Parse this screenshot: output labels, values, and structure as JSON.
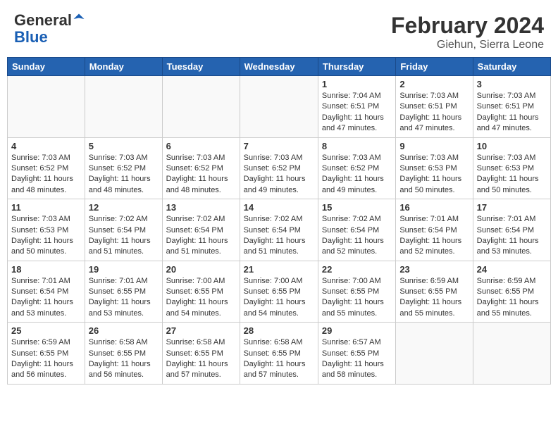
{
  "header": {
    "logo_general": "General",
    "logo_blue": "Blue",
    "month_title": "February 2024",
    "location": "Giehun, Sierra Leone"
  },
  "days_of_week": [
    "Sunday",
    "Monday",
    "Tuesday",
    "Wednesday",
    "Thursday",
    "Friday",
    "Saturday"
  ],
  "weeks": [
    [
      {
        "day": "",
        "content": ""
      },
      {
        "day": "",
        "content": ""
      },
      {
        "day": "",
        "content": ""
      },
      {
        "day": "",
        "content": ""
      },
      {
        "day": "1",
        "content": "Sunrise: 7:04 AM\nSunset: 6:51 PM\nDaylight: 11 hours and 47 minutes."
      },
      {
        "day": "2",
        "content": "Sunrise: 7:03 AM\nSunset: 6:51 PM\nDaylight: 11 hours and 47 minutes."
      },
      {
        "day": "3",
        "content": "Sunrise: 7:03 AM\nSunset: 6:51 PM\nDaylight: 11 hours and 47 minutes."
      }
    ],
    [
      {
        "day": "4",
        "content": "Sunrise: 7:03 AM\nSunset: 6:52 PM\nDaylight: 11 hours and 48 minutes."
      },
      {
        "day": "5",
        "content": "Sunrise: 7:03 AM\nSunset: 6:52 PM\nDaylight: 11 hours and 48 minutes."
      },
      {
        "day": "6",
        "content": "Sunrise: 7:03 AM\nSunset: 6:52 PM\nDaylight: 11 hours and 48 minutes."
      },
      {
        "day": "7",
        "content": "Sunrise: 7:03 AM\nSunset: 6:52 PM\nDaylight: 11 hours and 49 minutes."
      },
      {
        "day": "8",
        "content": "Sunrise: 7:03 AM\nSunset: 6:52 PM\nDaylight: 11 hours and 49 minutes."
      },
      {
        "day": "9",
        "content": "Sunrise: 7:03 AM\nSunset: 6:53 PM\nDaylight: 11 hours and 50 minutes."
      },
      {
        "day": "10",
        "content": "Sunrise: 7:03 AM\nSunset: 6:53 PM\nDaylight: 11 hours and 50 minutes."
      }
    ],
    [
      {
        "day": "11",
        "content": "Sunrise: 7:03 AM\nSunset: 6:53 PM\nDaylight: 11 hours and 50 minutes."
      },
      {
        "day": "12",
        "content": "Sunrise: 7:02 AM\nSunset: 6:54 PM\nDaylight: 11 hours and 51 minutes."
      },
      {
        "day": "13",
        "content": "Sunrise: 7:02 AM\nSunset: 6:54 PM\nDaylight: 11 hours and 51 minutes."
      },
      {
        "day": "14",
        "content": "Sunrise: 7:02 AM\nSunset: 6:54 PM\nDaylight: 11 hours and 51 minutes."
      },
      {
        "day": "15",
        "content": "Sunrise: 7:02 AM\nSunset: 6:54 PM\nDaylight: 11 hours and 52 minutes."
      },
      {
        "day": "16",
        "content": "Sunrise: 7:01 AM\nSunset: 6:54 PM\nDaylight: 11 hours and 52 minutes."
      },
      {
        "day": "17",
        "content": "Sunrise: 7:01 AM\nSunset: 6:54 PM\nDaylight: 11 hours and 53 minutes."
      }
    ],
    [
      {
        "day": "18",
        "content": "Sunrise: 7:01 AM\nSunset: 6:54 PM\nDaylight: 11 hours and 53 minutes."
      },
      {
        "day": "19",
        "content": "Sunrise: 7:01 AM\nSunset: 6:55 PM\nDaylight: 11 hours and 53 minutes."
      },
      {
        "day": "20",
        "content": "Sunrise: 7:00 AM\nSunset: 6:55 PM\nDaylight: 11 hours and 54 minutes."
      },
      {
        "day": "21",
        "content": "Sunrise: 7:00 AM\nSunset: 6:55 PM\nDaylight: 11 hours and 54 minutes."
      },
      {
        "day": "22",
        "content": "Sunrise: 7:00 AM\nSunset: 6:55 PM\nDaylight: 11 hours and 55 minutes."
      },
      {
        "day": "23",
        "content": "Sunrise: 6:59 AM\nSunset: 6:55 PM\nDaylight: 11 hours and 55 minutes."
      },
      {
        "day": "24",
        "content": "Sunrise: 6:59 AM\nSunset: 6:55 PM\nDaylight: 11 hours and 55 minutes."
      }
    ],
    [
      {
        "day": "25",
        "content": "Sunrise: 6:59 AM\nSunset: 6:55 PM\nDaylight: 11 hours and 56 minutes."
      },
      {
        "day": "26",
        "content": "Sunrise: 6:58 AM\nSunset: 6:55 PM\nDaylight: 11 hours and 56 minutes."
      },
      {
        "day": "27",
        "content": "Sunrise: 6:58 AM\nSunset: 6:55 PM\nDaylight: 11 hours and 57 minutes."
      },
      {
        "day": "28",
        "content": "Sunrise: 6:58 AM\nSunset: 6:55 PM\nDaylight: 11 hours and 57 minutes."
      },
      {
        "day": "29",
        "content": "Sunrise: 6:57 AM\nSunset: 6:55 PM\nDaylight: 11 hours and 58 minutes."
      },
      {
        "day": "",
        "content": ""
      },
      {
        "day": "",
        "content": ""
      }
    ]
  ]
}
